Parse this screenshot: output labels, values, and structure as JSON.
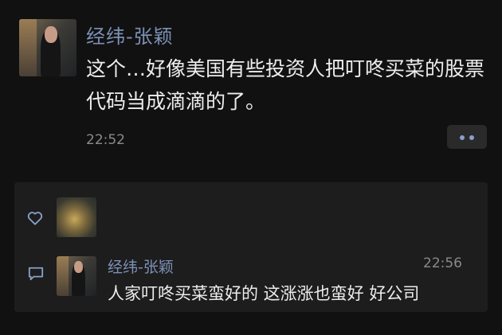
{
  "post": {
    "author": "经纬-张颖",
    "text": "这个…好像美国有些投资人把叮咚买菜的股票代码当成滴滴的了。",
    "time": "22:52"
  },
  "likes": {
    "icon": "heart-icon"
  },
  "comment": {
    "icon": "comment-icon",
    "author": "经纬-张颖",
    "time": "22:56",
    "text": "人家叮咚买菜蛮好的 这涨涨也蛮好 好公司"
  },
  "colors": {
    "background": "#111111",
    "panel": "#1d1d1d",
    "name": "#7d90b6",
    "text": "#ededed",
    "meta": "#8a8a8a"
  }
}
